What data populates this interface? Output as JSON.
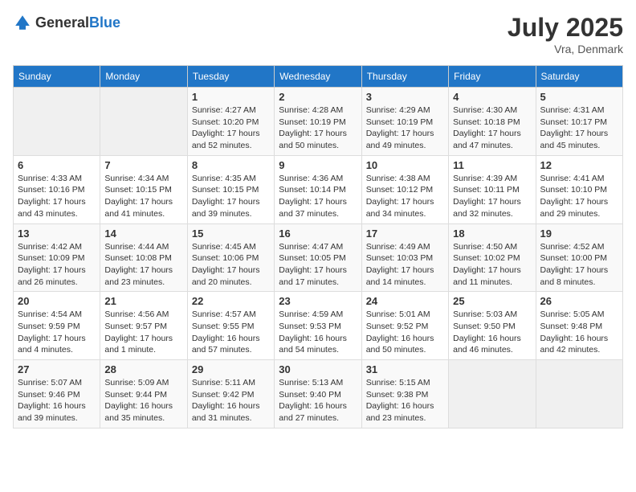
{
  "header": {
    "logo_general": "General",
    "logo_blue": "Blue",
    "month_year": "July 2025",
    "location": "Vra, Denmark"
  },
  "days_of_week": [
    "Sunday",
    "Monday",
    "Tuesday",
    "Wednesday",
    "Thursday",
    "Friday",
    "Saturday"
  ],
  "weeks": [
    [
      {
        "day": "",
        "info": ""
      },
      {
        "day": "",
        "info": ""
      },
      {
        "day": "1",
        "info": "Sunrise: 4:27 AM\nSunset: 10:20 PM\nDaylight: 17 hours\nand 52 minutes."
      },
      {
        "day": "2",
        "info": "Sunrise: 4:28 AM\nSunset: 10:19 PM\nDaylight: 17 hours\nand 50 minutes."
      },
      {
        "day": "3",
        "info": "Sunrise: 4:29 AM\nSunset: 10:19 PM\nDaylight: 17 hours\nand 49 minutes."
      },
      {
        "day": "4",
        "info": "Sunrise: 4:30 AM\nSunset: 10:18 PM\nDaylight: 17 hours\nand 47 minutes."
      },
      {
        "day": "5",
        "info": "Sunrise: 4:31 AM\nSunset: 10:17 PM\nDaylight: 17 hours\nand 45 minutes."
      }
    ],
    [
      {
        "day": "6",
        "info": "Sunrise: 4:33 AM\nSunset: 10:16 PM\nDaylight: 17 hours\nand 43 minutes."
      },
      {
        "day": "7",
        "info": "Sunrise: 4:34 AM\nSunset: 10:15 PM\nDaylight: 17 hours\nand 41 minutes."
      },
      {
        "day": "8",
        "info": "Sunrise: 4:35 AM\nSunset: 10:15 PM\nDaylight: 17 hours\nand 39 minutes."
      },
      {
        "day": "9",
        "info": "Sunrise: 4:36 AM\nSunset: 10:14 PM\nDaylight: 17 hours\nand 37 minutes."
      },
      {
        "day": "10",
        "info": "Sunrise: 4:38 AM\nSunset: 10:12 PM\nDaylight: 17 hours\nand 34 minutes."
      },
      {
        "day": "11",
        "info": "Sunrise: 4:39 AM\nSunset: 10:11 PM\nDaylight: 17 hours\nand 32 minutes."
      },
      {
        "day": "12",
        "info": "Sunrise: 4:41 AM\nSunset: 10:10 PM\nDaylight: 17 hours\nand 29 minutes."
      }
    ],
    [
      {
        "day": "13",
        "info": "Sunrise: 4:42 AM\nSunset: 10:09 PM\nDaylight: 17 hours\nand 26 minutes."
      },
      {
        "day": "14",
        "info": "Sunrise: 4:44 AM\nSunset: 10:08 PM\nDaylight: 17 hours\nand 23 minutes."
      },
      {
        "day": "15",
        "info": "Sunrise: 4:45 AM\nSunset: 10:06 PM\nDaylight: 17 hours\nand 20 minutes."
      },
      {
        "day": "16",
        "info": "Sunrise: 4:47 AM\nSunset: 10:05 PM\nDaylight: 17 hours\nand 17 minutes."
      },
      {
        "day": "17",
        "info": "Sunrise: 4:49 AM\nSunset: 10:03 PM\nDaylight: 17 hours\nand 14 minutes."
      },
      {
        "day": "18",
        "info": "Sunrise: 4:50 AM\nSunset: 10:02 PM\nDaylight: 17 hours\nand 11 minutes."
      },
      {
        "day": "19",
        "info": "Sunrise: 4:52 AM\nSunset: 10:00 PM\nDaylight: 17 hours\nand 8 minutes."
      }
    ],
    [
      {
        "day": "20",
        "info": "Sunrise: 4:54 AM\nSunset: 9:59 PM\nDaylight: 17 hours\nand 4 minutes."
      },
      {
        "day": "21",
        "info": "Sunrise: 4:56 AM\nSunset: 9:57 PM\nDaylight: 17 hours\nand 1 minute."
      },
      {
        "day": "22",
        "info": "Sunrise: 4:57 AM\nSunset: 9:55 PM\nDaylight: 16 hours\nand 57 minutes."
      },
      {
        "day": "23",
        "info": "Sunrise: 4:59 AM\nSunset: 9:53 PM\nDaylight: 16 hours\nand 54 minutes."
      },
      {
        "day": "24",
        "info": "Sunrise: 5:01 AM\nSunset: 9:52 PM\nDaylight: 16 hours\nand 50 minutes."
      },
      {
        "day": "25",
        "info": "Sunrise: 5:03 AM\nSunset: 9:50 PM\nDaylight: 16 hours\nand 46 minutes."
      },
      {
        "day": "26",
        "info": "Sunrise: 5:05 AM\nSunset: 9:48 PM\nDaylight: 16 hours\nand 42 minutes."
      }
    ],
    [
      {
        "day": "27",
        "info": "Sunrise: 5:07 AM\nSunset: 9:46 PM\nDaylight: 16 hours\nand 39 minutes."
      },
      {
        "day": "28",
        "info": "Sunrise: 5:09 AM\nSunset: 9:44 PM\nDaylight: 16 hours\nand 35 minutes."
      },
      {
        "day": "29",
        "info": "Sunrise: 5:11 AM\nSunset: 9:42 PM\nDaylight: 16 hours\nand 31 minutes."
      },
      {
        "day": "30",
        "info": "Sunrise: 5:13 AM\nSunset: 9:40 PM\nDaylight: 16 hours\nand 27 minutes."
      },
      {
        "day": "31",
        "info": "Sunrise: 5:15 AM\nSunset: 9:38 PM\nDaylight: 16 hours\nand 23 minutes."
      },
      {
        "day": "",
        "info": ""
      },
      {
        "day": "",
        "info": ""
      }
    ]
  ]
}
